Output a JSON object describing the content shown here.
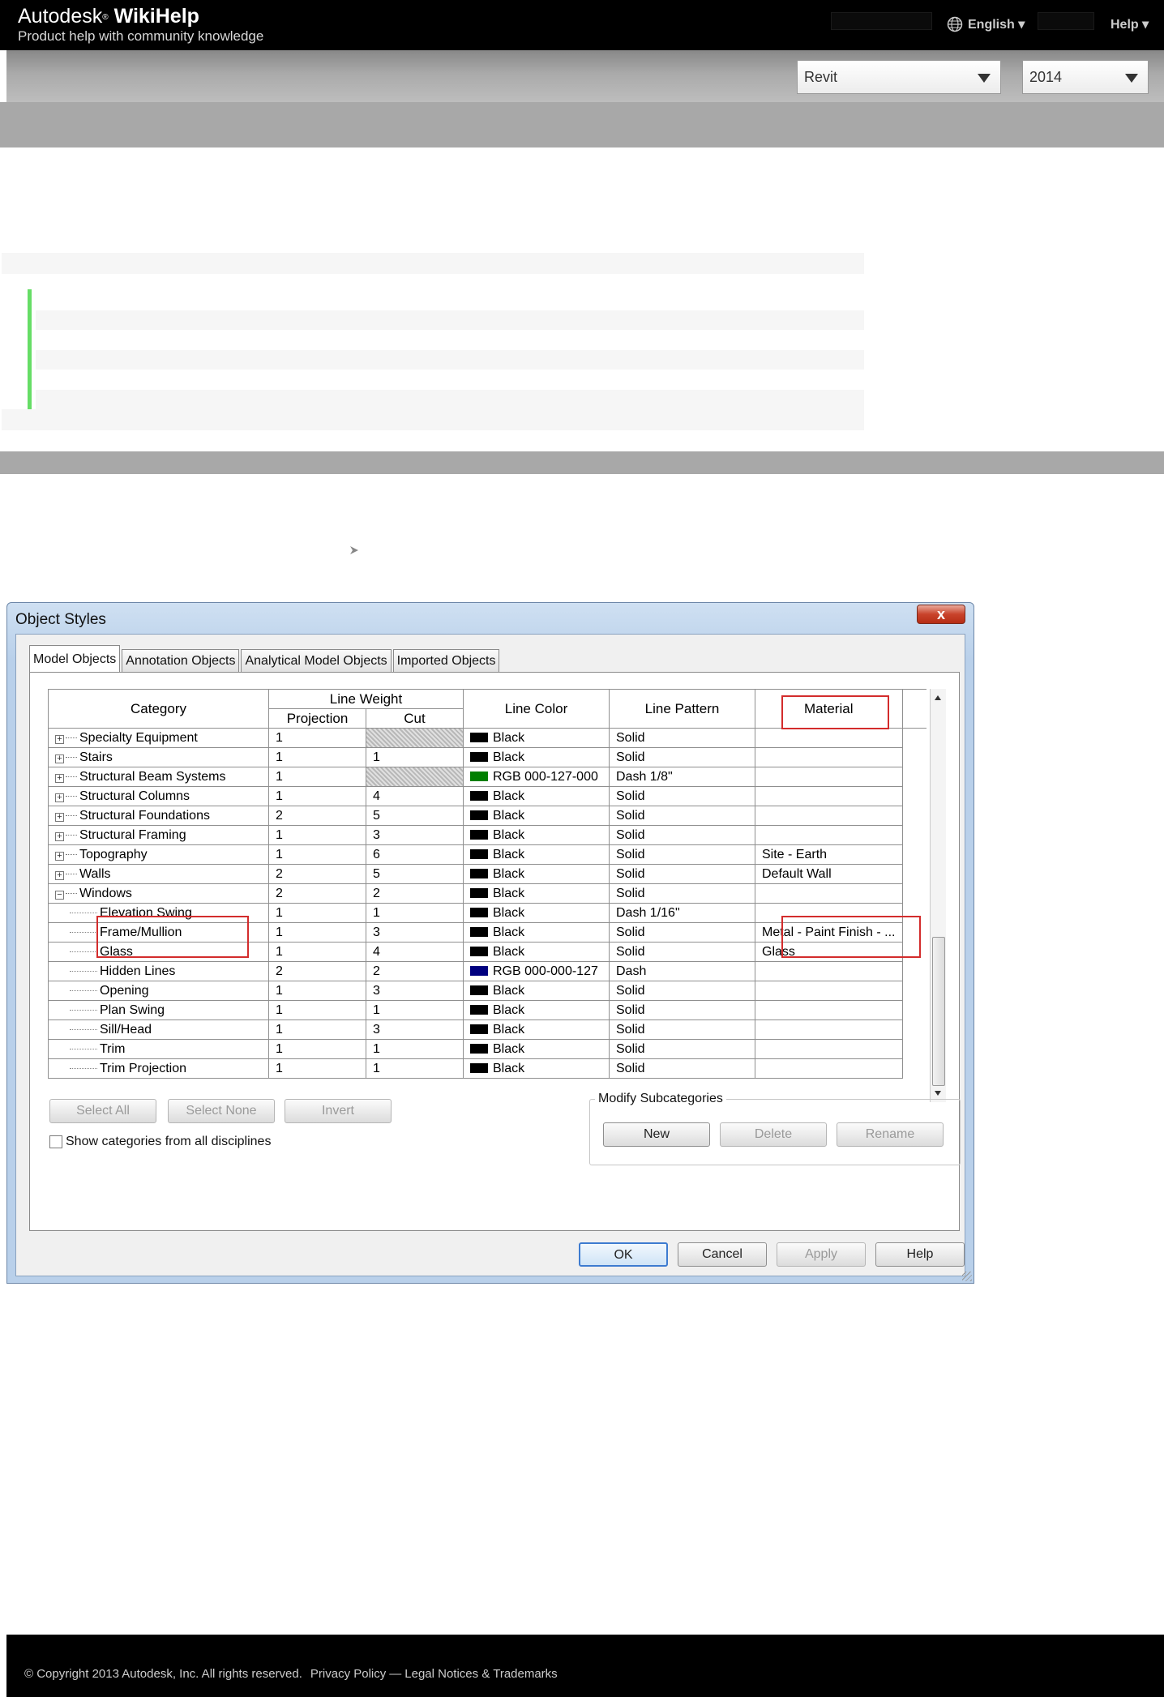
{
  "header": {
    "brand_prefix": "Autodesk",
    "brand_mark": "®",
    "brand_product": "WikiHelp",
    "tagline": "Product help with community knowledge",
    "language": "English ▾",
    "help": "Help ▾"
  },
  "selectors": {
    "product": "Revit",
    "version": "2014"
  },
  "dialog": {
    "title": "Object Styles",
    "close": "x",
    "tabs": [
      "Model Objects",
      "Annotation Objects",
      "Analytical Model Objects",
      "Imported Objects"
    ],
    "active_tab": "Model Objects",
    "columns": {
      "category": "Category",
      "line_weight": "Line Weight",
      "projection": "Projection",
      "cut": "Cut",
      "line_color": "Line Color",
      "line_pattern": "Line Pattern",
      "material": "Material"
    },
    "rows": [
      {
        "cat": "Specialty Equipment",
        "tree": "+",
        "proj": "1",
        "cut": "",
        "cut_hatch": true,
        "color_name": "Black",
        "swatch": "#000000",
        "pattern": "Solid",
        "material": ""
      },
      {
        "cat": "Stairs",
        "tree": "+",
        "proj": "1",
        "cut": "1",
        "cut_hatch": false,
        "color_name": "Black",
        "swatch": "#000000",
        "pattern": "Solid",
        "material": ""
      },
      {
        "cat": "Structural Beam Systems",
        "tree": "+",
        "proj": "1",
        "cut": "",
        "cut_hatch": true,
        "color_name": "RGB 000-127-000",
        "swatch": "#007f00",
        "pattern": "Dash 1/8\"",
        "material": ""
      },
      {
        "cat": "Structural Columns",
        "tree": "+",
        "proj": "1",
        "cut": "4",
        "cut_hatch": false,
        "color_name": "Black",
        "swatch": "#000000",
        "pattern": "Solid",
        "material": ""
      },
      {
        "cat": "Structural Foundations",
        "tree": "+",
        "proj": "2",
        "cut": "5",
        "cut_hatch": false,
        "color_name": "Black",
        "swatch": "#000000",
        "pattern": "Solid",
        "material": ""
      },
      {
        "cat": "Structural Framing",
        "tree": "+",
        "proj": "1",
        "cut": "3",
        "cut_hatch": false,
        "color_name": "Black",
        "swatch": "#000000",
        "pattern": "Solid",
        "material": ""
      },
      {
        "cat": "Topography",
        "tree": "+",
        "proj": "1",
        "cut": "6",
        "cut_hatch": false,
        "color_name": "Black",
        "swatch": "#000000",
        "pattern": "Solid",
        "material": "Site - Earth"
      },
      {
        "cat": "Walls",
        "tree": "+",
        "proj": "2",
        "cut": "5",
        "cut_hatch": false,
        "color_name": "Black",
        "swatch": "#000000",
        "pattern": "Solid",
        "material": "Default Wall"
      },
      {
        "cat": "Windows",
        "tree": "−",
        "proj": "2",
        "cut": "2",
        "cut_hatch": false,
        "color_name": "Black",
        "swatch": "#000000",
        "pattern": "Solid",
        "material": ""
      },
      {
        "cat": "Elevation Swing",
        "tree": "sub",
        "proj": "1",
        "cut": "1",
        "cut_hatch": false,
        "color_name": "Black",
        "swatch": "#000000",
        "pattern": "Dash 1/16\"",
        "material": ""
      },
      {
        "cat": "Frame/Mullion",
        "tree": "sub",
        "proj": "1",
        "cut": "3",
        "cut_hatch": false,
        "color_name": "Black",
        "swatch": "#000000",
        "pattern": "Solid",
        "material": "Metal - Paint Finish - ..."
      },
      {
        "cat": "Glass",
        "tree": "sub",
        "proj": "1",
        "cut": "4",
        "cut_hatch": false,
        "color_name": "Black",
        "swatch": "#000000",
        "pattern": "Solid",
        "material": "Glass"
      },
      {
        "cat": "Hidden Lines",
        "tree": "sub",
        "proj": "2",
        "cut": "2",
        "cut_hatch": false,
        "color_name": "RGB 000-000-127",
        "swatch": "#00007f",
        "pattern": "Dash",
        "material": ""
      },
      {
        "cat": "Opening",
        "tree": "sub",
        "proj": "1",
        "cut": "3",
        "cut_hatch": false,
        "color_name": "Black",
        "swatch": "#000000",
        "pattern": "Solid",
        "material": ""
      },
      {
        "cat": "Plan Swing",
        "tree": "sub",
        "proj": "1",
        "cut": "1",
        "cut_hatch": false,
        "color_name": "Black",
        "swatch": "#000000",
        "pattern": "Solid",
        "material": ""
      },
      {
        "cat": "Sill/Head",
        "tree": "sub",
        "proj": "1",
        "cut": "3",
        "cut_hatch": false,
        "color_name": "Black",
        "swatch": "#000000",
        "pattern": "Solid",
        "material": ""
      },
      {
        "cat": "Trim",
        "tree": "sub",
        "proj": "1",
        "cut": "1",
        "cut_hatch": false,
        "color_name": "Black",
        "swatch": "#000000",
        "pattern": "Solid",
        "material": ""
      },
      {
        "cat": "Trim Projection",
        "tree": "sub",
        "proj": "1",
        "cut": "1",
        "cut_hatch": false,
        "color_name": "Black",
        "swatch": "#000000",
        "pattern": "Solid",
        "material": ""
      }
    ],
    "select_all": "Select All",
    "select_none": "Select None",
    "invert": "Invert",
    "modify_subcategories": "Modify Subcategories",
    "new": "New",
    "delete": "Delete",
    "rename": "Rename",
    "show_all_disciplines": "Show categories from all disciplines",
    "ok": "OK",
    "cancel": "Cancel",
    "apply": "Apply",
    "help": "Help"
  },
  "footer": {
    "copyright": "© Copyright 2013 Autodesk, Inc. All rights reserved.",
    "privacy": "Privacy Policy",
    "separator": "—",
    "legal": "Legal Notices & Trademarks"
  },
  "colors": {
    "highlight_red": "#d32c2c",
    "green_accent": "#66dd66"
  }
}
